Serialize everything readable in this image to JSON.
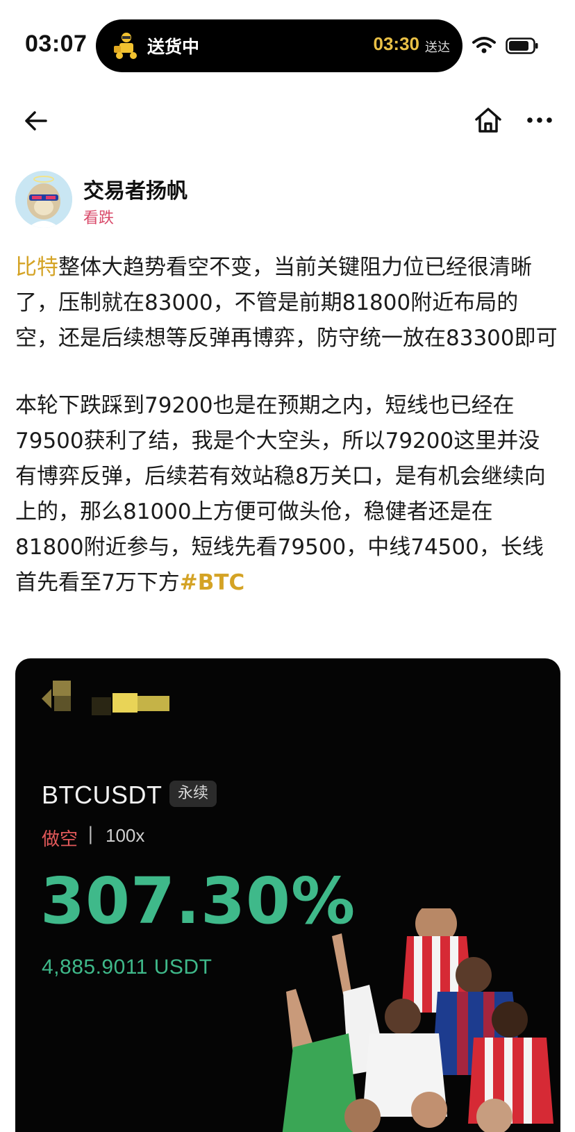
{
  "status_bar": {
    "time": "03:07",
    "island_status": "送货中",
    "island_eta": "03:30",
    "island_eta_label": "送达",
    "icons": [
      "courier-icon",
      "wifi-icon",
      "battery-icon"
    ]
  },
  "nav": {
    "icons": [
      "back-arrow-icon",
      "home-icon",
      "more-icon"
    ]
  },
  "author": {
    "name": "交易者扬帆",
    "tag": "看跌",
    "tag_color": "#d94a6a"
  },
  "post": {
    "p1_coin": "比特",
    "p1_text": "整体大趋势看空不变，当前关键阻力位已经很清晰了，压制就在83000，不管是前期81800附近布局的空，还是后续想等反弹再博弈，防守统一放在83300即可",
    "p2_text": "本轮下跌踩到79200也是在预期之内，短线也已经在79500获利了结，我是个大空头，所以79200这里并没有博弈反弹，后续若有效站稳8万关口，是有机会继续向上的，那么81000上方便可做头伧，稳健者还是在81800附近参与，短线先看79500，中线74500，长线首先看至7万下方",
    "p2_hashtag": "#BTC",
    "accent_color": "#d4a325"
  },
  "card": {
    "pair": "BTCUSDT",
    "pair_type": "永续",
    "side": "做空",
    "separator": "|",
    "leverage": "100x",
    "roi": "307.30%",
    "pnl": "4,885.9011 USDT",
    "profit_color": "#3fb98a",
    "short_color": "#e3595a"
  }
}
